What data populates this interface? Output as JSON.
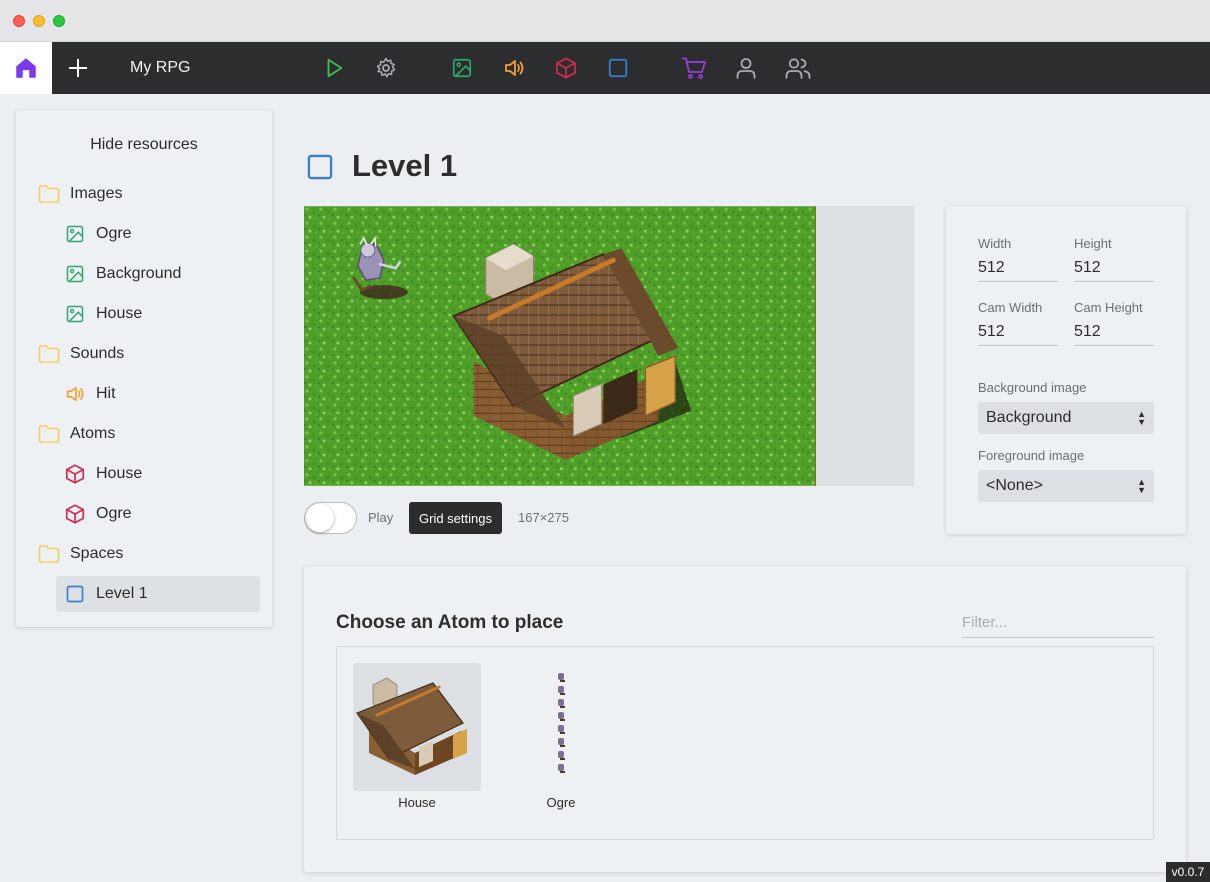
{
  "app": {
    "title": "My RPG",
    "version": "v0.0.7"
  },
  "toolbar": {
    "items": [
      "home-icon",
      "plus-icon",
      "play-icon",
      "gear-icon",
      "image-icon",
      "sound-icon",
      "atom-icon",
      "space-icon",
      "cart-icon",
      "user-icon",
      "users-icon"
    ]
  },
  "colors": {
    "home": "#7c3aed",
    "play": "#3fbf52",
    "image": "#2fa86a",
    "sound": "#f0a030",
    "atom": "#d0294f",
    "space": "#3a7fd0",
    "cart": "#9b3fd8",
    "folder": "#f3d15c",
    "toolbar_bg": "#2b2d2f"
  },
  "sidebar": {
    "hide_label": "Hide resources",
    "tree": [
      {
        "label": "Images",
        "icon": "folder-icon",
        "kind": "folder"
      },
      {
        "label": "Ogre",
        "icon": "image-icon",
        "kind": "child"
      },
      {
        "label": "Background",
        "icon": "image-icon",
        "kind": "child"
      },
      {
        "label": "House",
        "icon": "image-icon",
        "kind": "child"
      },
      {
        "label": "Sounds",
        "icon": "folder-icon",
        "kind": "folder"
      },
      {
        "label": "Hit",
        "icon": "sound-icon",
        "kind": "child"
      },
      {
        "label": "Atoms",
        "icon": "folder-icon",
        "kind": "folder"
      },
      {
        "label": "House",
        "icon": "atom-icon",
        "kind": "child"
      },
      {
        "label": "Ogre",
        "icon": "atom-icon",
        "kind": "child"
      },
      {
        "label": "Spaces",
        "icon": "folder-icon",
        "kind": "folder"
      },
      {
        "label": "Level 1",
        "icon": "space-icon",
        "kind": "child",
        "selected": true
      }
    ]
  },
  "main": {
    "title": "Level 1",
    "play_label": "Play",
    "play_on": false,
    "grid_settings_label": "Grid settings",
    "coords": "167×275"
  },
  "props": {
    "width_label": "Width",
    "width_value": "512",
    "height_label": "Height",
    "height_value": "512",
    "cam_width_label": "Cam Width",
    "cam_width_value": "512",
    "cam_height_label": "Cam Height",
    "cam_height_value": "512",
    "bg_label": "Background image",
    "bg_value": "Background",
    "fg_label": "Foreground image",
    "fg_value": "<None>"
  },
  "chooser": {
    "title": "Choose an Atom to place",
    "filter_placeholder": "Filter...",
    "atoms": [
      {
        "label": "House",
        "active": true
      },
      {
        "label": "Ogre",
        "active": false
      }
    ]
  }
}
